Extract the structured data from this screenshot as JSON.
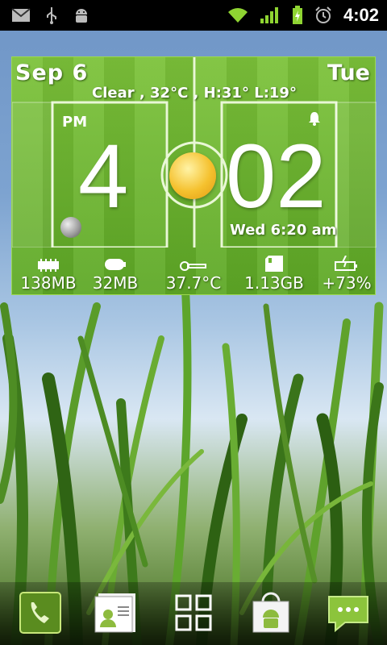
{
  "status_bar": {
    "time": "4:02",
    "icons": [
      "gmail-icon",
      "usb-icon",
      "android-debug-icon",
      "wifi-icon",
      "signal-icon",
      "battery-charging-icon",
      "alarm-clock-icon"
    ]
  },
  "widget": {
    "date": "Sep  6",
    "weekday": "Tue",
    "weather": "Clear , 32°C , H:31° L:19°",
    "ampm": "PM",
    "hour": "4",
    "minute": "02",
    "next_alarm": "Wed 6:20 am",
    "stats": [
      {
        "icon": "ram-chip-icon",
        "value": "138MB"
      },
      {
        "icon": "storage-icon",
        "value": "32MB"
      },
      {
        "icon": "thermometer-icon",
        "value": "37.7°C"
      },
      {
        "icon": "sd-card-icon",
        "value": "1.13GB"
      },
      {
        "icon": "battery-icon",
        "value": "+73%"
      }
    ]
  },
  "dock": {
    "items": [
      "phone-icon",
      "contacts-icon",
      "app-drawer-icon",
      "market-icon",
      "messaging-icon"
    ]
  },
  "colors": {
    "field_green": "#6bb52f",
    "status_bar": "#000000",
    "signal_green": "#8fd432"
  }
}
